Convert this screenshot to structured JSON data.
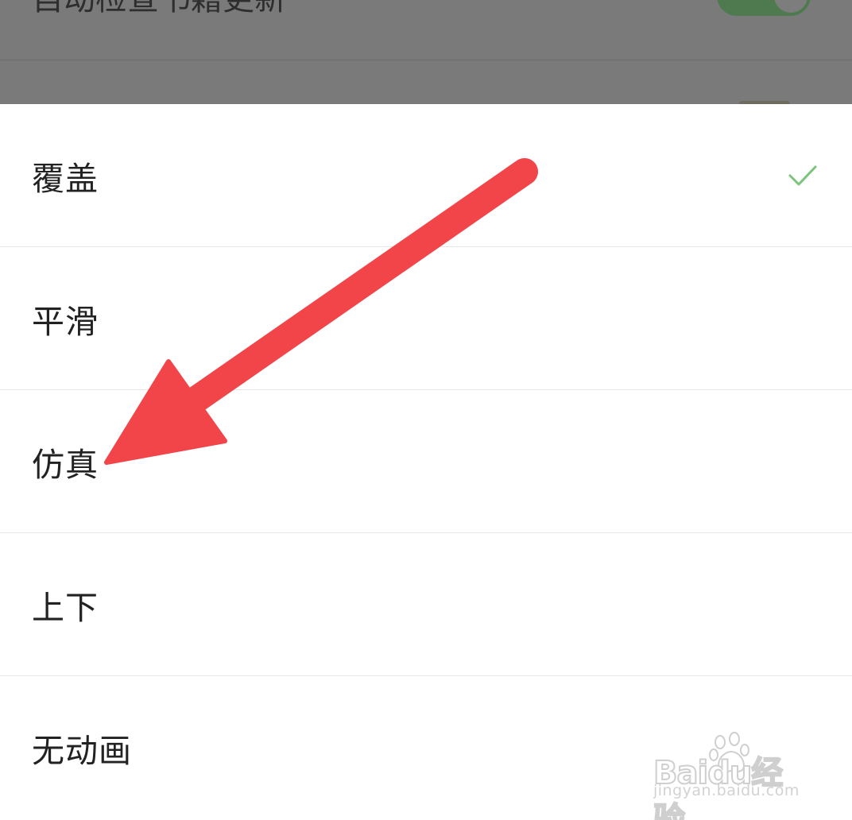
{
  "background": {
    "row_label": "自动检查书籍更新"
  },
  "sheet": {
    "options": [
      {
        "label": "覆盖",
        "selected": true
      },
      {
        "label": "平滑",
        "selected": false
      },
      {
        "label": "仿真",
        "selected": false
      },
      {
        "label": "上下",
        "selected": false
      },
      {
        "label": "无动画",
        "selected": false
      }
    ]
  },
  "icons": {
    "selected": "check-icon",
    "annotation": "arrow-icon"
  },
  "colors": {
    "accent": "#7cc47c",
    "arrow": "#f2454a",
    "overlay": "#7a7a7a"
  },
  "watermark": {
    "logo": "Baidu经验",
    "url": "jingyan.baidu.com"
  }
}
